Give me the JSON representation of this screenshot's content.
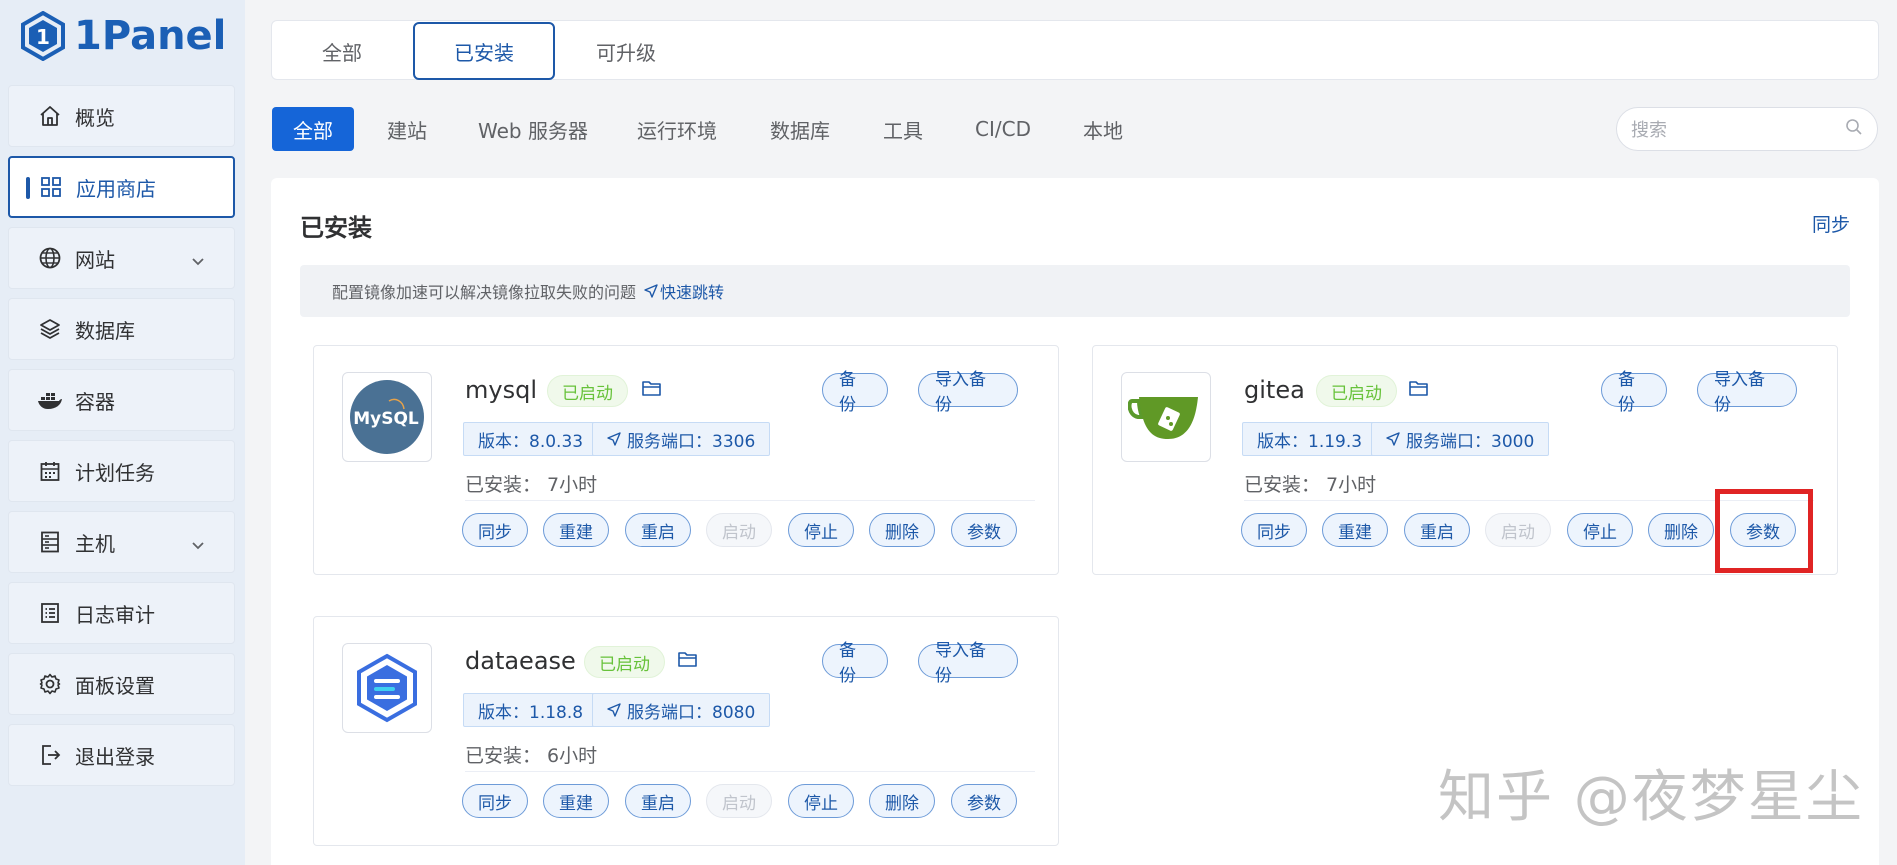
{
  "brand": {
    "name": "1Panel"
  },
  "sidebar": {
    "items": [
      {
        "label": "概览",
        "icon": "home-icon"
      },
      {
        "label": "应用商店",
        "icon": "apps-grid-icon",
        "active": true
      },
      {
        "label": "网站",
        "icon": "globe-icon",
        "expandable": true
      },
      {
        "label": "数据库",
        "icon": "layers-icon"
      },
      {
        "label": "容器",
        "icon": "docker-icon"
      },
      {
        "label": "计划任务",
        "icon": "calendar-icon"
      },
      {
        "label": "主机",
        "icon": "server-icon",
        "expandable": true
      },
      {
        "label": "日志审计",
        "icon": "log-icon"
      },
      {
        "label": "面板设置",
        "icon": "gear-icon"
      },
      {
        "label": "退出登录",
        "icon": "logout-icon"
      }
    ]
  },
  "top_tabs": [
    {
      "label": "全部"
    },
    {
      "label": "已安装",
      "active": true
    },
    {
      "label": "可升级"
    }
  ],
  "categories": [
    {
      "label": "全部",
      "active": true
    },
    {
      "label": "建站"
    },
    {
      "label": "Web 服务器"
    },
    {
      "label": "运行环境"
    },
    {
      "label": "数据库"
    },
    {
      "label": "工具"
    },
    {
      "label": "CI/CD"
    },
    {
      "label": "本地"
    }
  ],
  "search": {
    "placeholder": "搜索"
  },
  "panel": {
    "title": "已安装",
    "sync_label": "同步",
    "notice_text": "配置镜像加速可以解决镜像拉取失败的问题",
    "notice_link": "快速跳转"
  },
  "apps": [
    {
      "name": "mysql",
      "status": "已启动",
      "backup_label": "备份",
      "import_label": "导入备份",
      "version": "版本：8.0.33",
      "port": "服务端口：3306",
      "installed": "已安装：  7小时",
      "actions": [
        "同步",
        "重建",
        "重启",
        "启动",
        "停止",
        "删除",
        "参数"
      ]
    },
    {
      "name": "gitea",
      "status": "已启动",
      "backup_label": "备份",
      "import_label": "导入备份",
      "version": "版本：1.19.3",
      "port": "服务端口：3000",
      "installed": "已安装：  7小时",
      "actions": [
        "同步",
        "重建",
        "重启",
        "启动",
        "停止",
        "删除",
        "参数"
      ]
    },
    {
      "name": "dataease",
      "status": "已启动",
      "backup_label": "备份",
      "import_label": "导入备份",
      "version": "版本：1.18.8",
      "port": "服务端口：8080",
      "installed": "已安装：  6小时",
      "actions": [
        "同步",
        "重建",
        "重启",
        "启动",
        "停止",
        "删除",
        "参数"
      ]
    }
  ],
  "logo_text": {
    "mysql": "MySQL"
  },
  "watermark": "知乎 @夜梦星尘",
  "colors": {
    "accent": "#1d58a8",
    "primary": "#1565d8",
    "success": "#67c23a",
    "highlight": "#e02424"
  }
}
